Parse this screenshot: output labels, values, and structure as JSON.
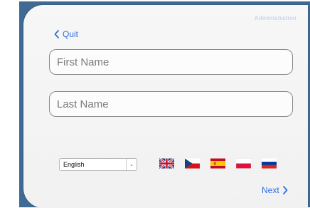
{
  "header": {
    "admin_label": "Administration"
  },
  "nav": {
    "quit_label": "Quit",
    "next_label": "Next"
  },
  "form": {
    "first_name": {
      "placeholder": "First Name",
      "value": ""
    },
    "last_name": {
      "placeholder": "Last Name",
      "value": ""
    }
  },
  "language": {
    "selected": "English",
    "flags": [
      {
        "icon": "uk-flag-icon"
      },
      {
        "icon": "czech-flag-icon"
      },
      {
        "icon": "spanish-flag-icon"
      },
      {
        "icon": "polish-flag-icon"
      },
      {
        "icon": "russian-flag-icon"
      }
    ]
  },
  "colors": {
    "accent": "#2f6fe0",
    "frame": "#3f6a94",
    "admin": "#c8d6ec"
  }
}
